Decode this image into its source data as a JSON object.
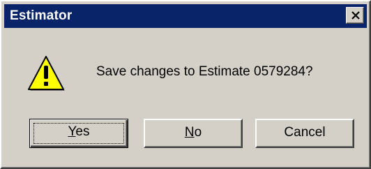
{
  "window": {
    "title": "Estimator",
    "close_icon": "close-icon"
  },
  "icon": {
    "name": "warning-icon",
    "color": "#ffff00"
  },
  "message": "Save changes to Estimate 0579284?",
  "buttons": {
    "yes": {
      "label_mnemonic": "Y",
      "label_rest": "es"
    },
    "no": {
      "label_mnemonic": "N",
      "label_rest": "o"
    },
    "cancel": {
      "label": "Cancel"
    }
  },
  "colors": {
    "titlebar": "#0a246a",
    "dialog_face": "#d4d0c8"
  }
}
